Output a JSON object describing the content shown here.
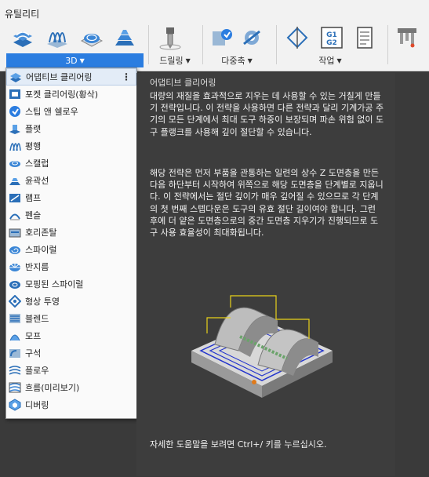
{
  "toolbar": {
    "tab_title": "유틸리티",
    "groups": [
      {
        "label": "3D"
      },
      {
        "label": "드릴링"
      },
      {
        "label": "다중축"
      },
      {
        "label": "작업"
      }
    ],
    "active_color": "#2b7de0"
  },
  "menu": {
    "items": [
      {
        "label": "어댑티브 클리어링",
        "icon": "adaptive-clearing-icon"
      },
      {
        "label": "포켓 클리어링(황삭)",
        "icon": "pocket-clearing-icon"
      },
      {
        "label": "스팁 앤 쉘로우",
        "icon": "steep-shallow-icon"
      },
      {
        "label": "플랫",
        "icon": "flat-icon"
      },
      {
        "label": "평행",
        "icon": "parallel-icon"
      },
      {
        "label": "스캘럽",
        "icon": "scallop-icon"
      },
      {
        "label": "윤곽선",
        "icon": "contour-icon"
      },
      {
        "label": "램프",
        "icon": "ramp-icon"
      },
      {
        "label": "펜슬",
        "icon": "pencil-icon"
      },
      {
        "label": "호리존탈",
        "icon": "horizontal-icon"
      },
      {
        "label": "스파이럴",
        "icon": "spiral-icon"
      },
      {
        "label": "반지름",
        "icon": "radial-icon"
      },
      {
        "label": "모핑된 스파이럴",
        "icon": "morphed-spiral-icon"
      },
      {
        "label": "형상 투영",
        "icon": "project-icon"
      },
      {
        "label": "블렌드",
        "icon": "blend-icon"
      },
      {
        "label": "모프",
        "icon": "morph-icon"
      },
      {
        "label": "구석",
        "icon": "corner-icon"
      },
      {
        "label": "플로우",
        "icon": "flow-icon"
      },
      {
        "label": "흐름(미리보기)",
        "icon": "flow-preview-icon"
      },
      {
        "label": "디버링",
        "icon": "deburr-icon"
      }
    ]
  },
  "tooltip": {
    "title": "어댑티브 클리어링",
    "para1": "대량의 재질을 효과적으로 지우는 데 사용할 수 있는 거칠게 만들기 전략입니다. 이 전략을 사용하면 다른 전략과 달리 기계가공 주기의 모든 단계에서 최대 도구 하중이 보장되며 파손 위험 없이 도구 플랭크를 사용해 깊이 절단할 수 있습니다.",
    "para2": "해당 전략은 먼저 부품을 관통하는 일련의 상수 Z 도면층을 만든 다음 하단부터 시작하여 위쪽으로 해당 도면층을 단계별로 지웁니다. 이 전략에서는 절단 깊이가 매우 깊어질 수 있으므로 각 단계의 첫 번째 스텝다운은 도구의 유효 절단 길이여야 합니다. 그런 후에 더 얕은 도면층으로의 중간 도면층 지우기가 진행되므로 도구 사용 효율성이 최대화됩니다.",
    "footer": "자세한 도움말을 보려면 Ctrl+/ 키를 누르십시오."
  }
}
